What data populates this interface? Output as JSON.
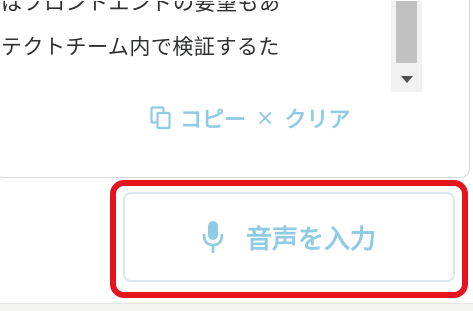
{
  "transcript": {
    "lines": [
      "はフロントエンドの要望もあ",
      "テクトチーム内で検証するた"
    ]
  },
  "actions": {
    "copy_icon": "copy-icon",
    "copy_label": "コピー",
    "separator": "×",
    "clear_label": "クリア"
  },
  "voice_input": {
    "icon": "microphone-icon",
    "label": "音声を入力"
  },
  "colors": {
    "accent": "#8fcbe5",
    "highlight": "#e5141f",
    "text": "#2d2f33"
  }
}
